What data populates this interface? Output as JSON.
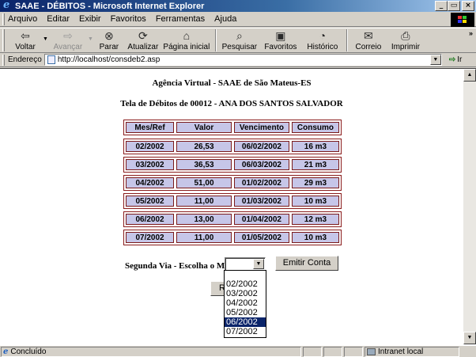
{
  "window": {
    "title": "SAAE - DÉBITOS - Microsoft Internet Explorer",
    "buttons": {
      "minimize": "_",
      "maximize": "▭",
      "close": "×"
    }
  },
  "menubar": {
    "items": [
      "Arquivo",
      "Editar",
      "Exibir",
      "Favoritos",
      "Ferramentas",
      "Ajuda"
    ]
  },
  "toolbar": {
    "back": "Voltar",
    "forward": "Avançar",
    "stop": "Parar",
    "refresh": "Atualizar",
    "home": "Página inicial",
    "search": "Pesquisar",
    "favorites": "Favoritos",
    "history": "Histórico",
    "mail": "Correio",
    "print": "Imprimir"
  },
  "addressbar": {
    "label": "Endereço",
    "url": "http://localhost/consdeb2.asp",
    "go": "Ir"
  },
  "page": {
    "heading": "Agência Virtual - SAAE de São Mateus-ES",
    "subheading": "Tela de Débitos de 00012 - ANA DOS SANTOS SALVADOR",
    "table": {
      "headers": [
        "Mes/Ref",
        "Valor",
        "Vencimento",
        "Consumo"
      ],
      "rows": [
        [
          "02/2002",
          "26,53",
          "06/02/2002",
          "16 m3"
        ],
        [
          "03/2002",
          "36,53",
          "06/03/2002",
          "21 m3"
        ],
        [
          "04/2002",
          "51,00",
          "01/02/2002",
          "29 m3"
        ],
        [
          "05/2002",
          "11,00",
          "01/03/2002",
          "10 m3"
        ],
        [
          "06/2002",
          "13,00",
          "01/04/2002",
          "12 m3"
        ],
        [
          "07/2002",
          "11,00",
          "01/05/2002",
          "10 m3"
        ]
      ]
    },
    "segunda_via_label": "Segunda Via - Escolha o Mês:",
    "select_value": "",
    "emitir_button": "Emitir Conta",
    "hidden_button_initial": "R",
    "dropdown_options": [
      "02/2002",
      "03/2002",
      "04/2002",
      "05/2002",
      "06/2002",
      "07/2002"
    ],
    "dropdown_selected": "06/2002"
  },
  "statusbar": {
    "status": "Concluído",
    "zone": "Intranet local"
  }
}
